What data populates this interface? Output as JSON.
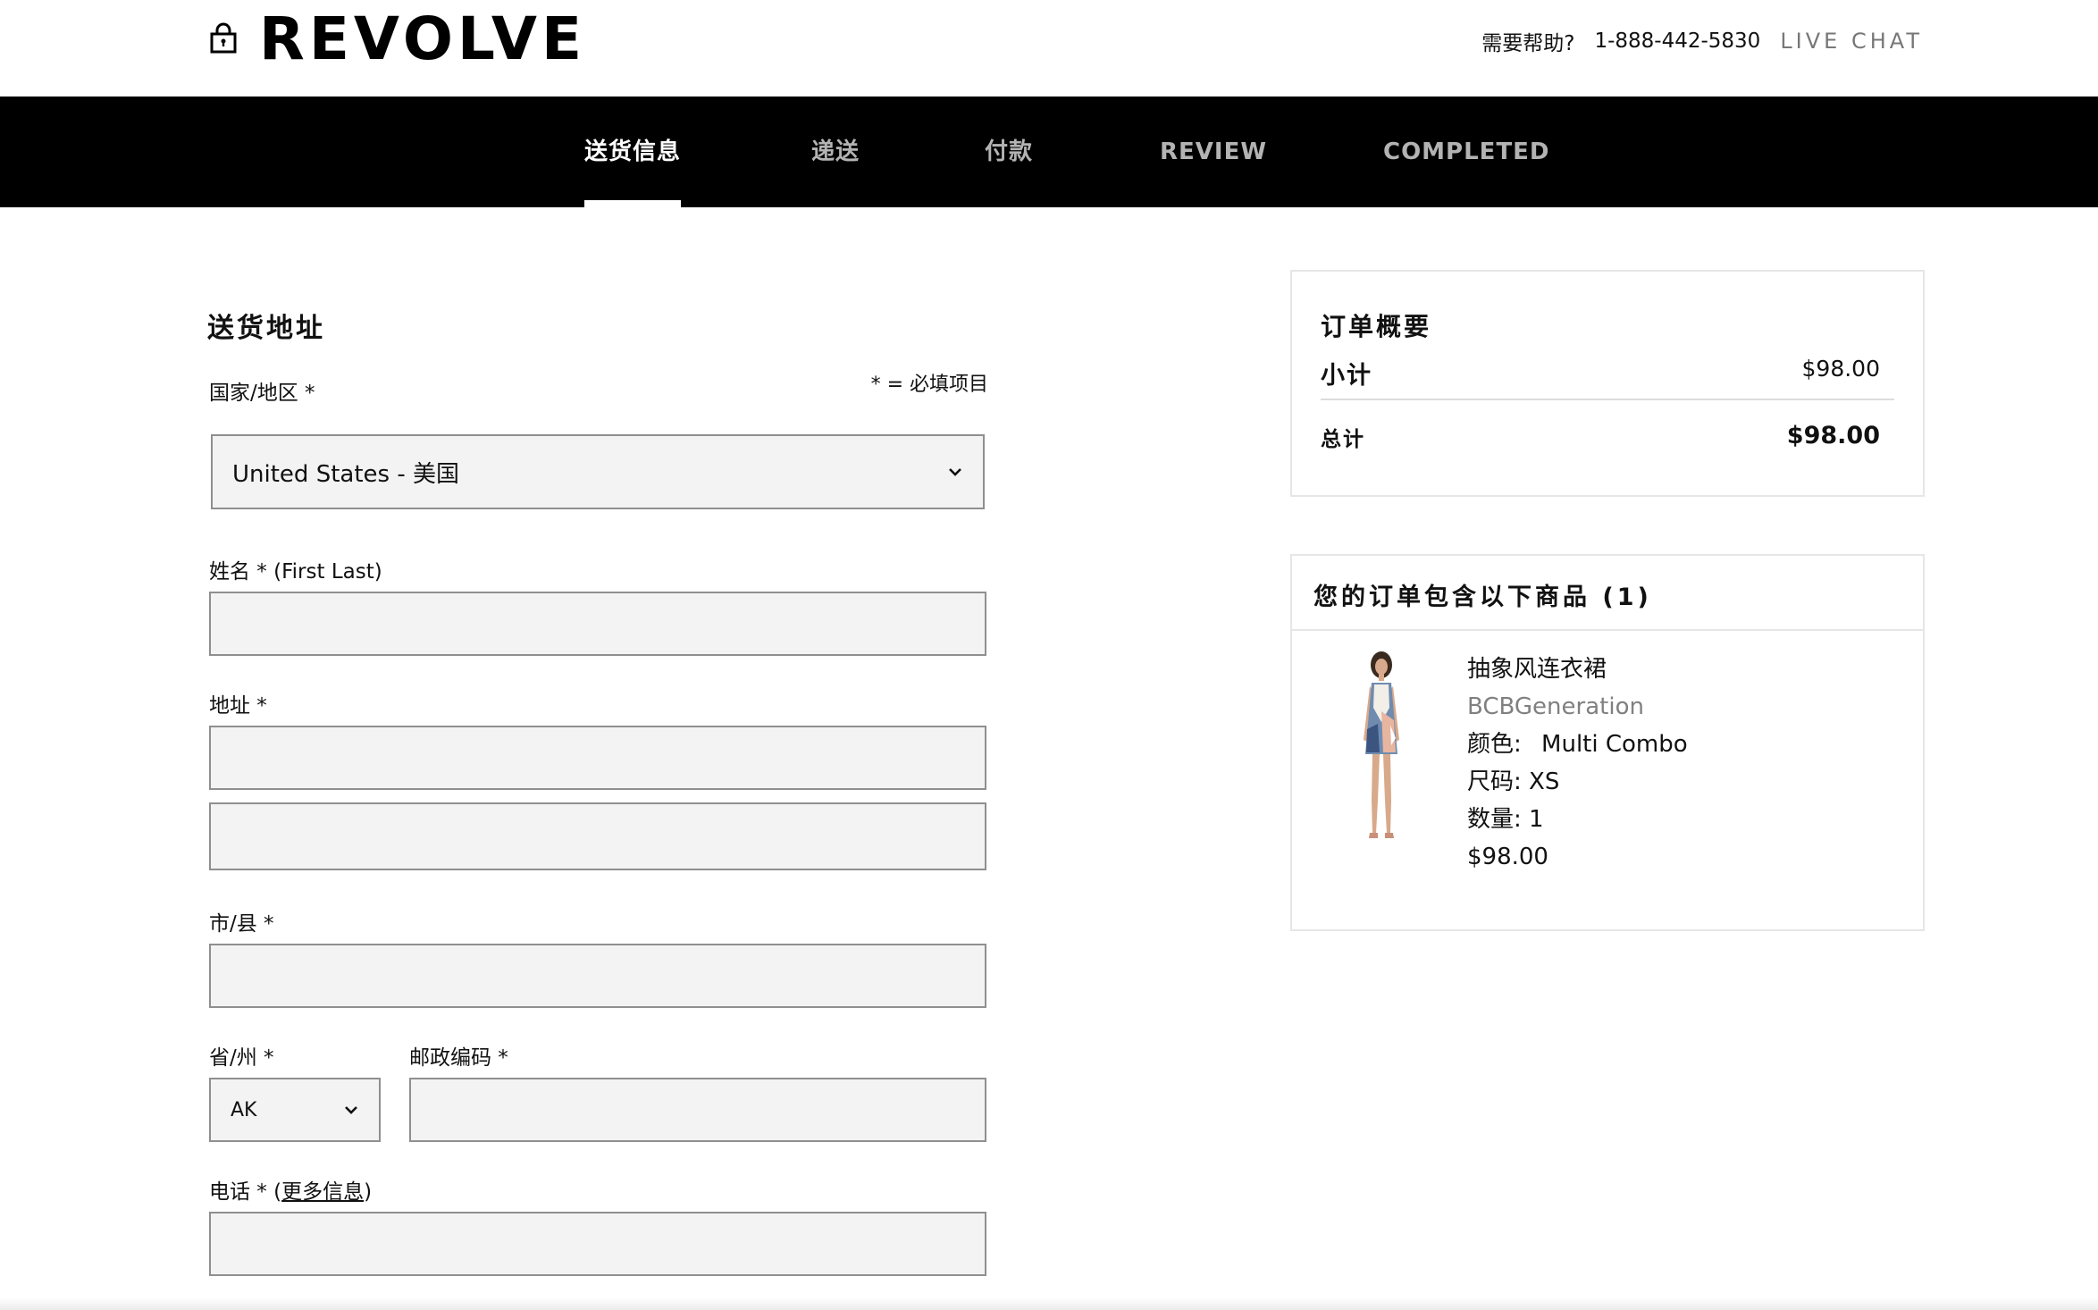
{
  "header": {
    "logo": "REVOLVE",
    "help_label": "需要帮助?",
    "phone": "1-888-442-5830",
    "live_chat": "LIVE CHAT"
  },
  "steps": [
    {
      "label": "送货信息",
      "active": true
    },
    {
      "label": "递送",
      "active": false
    },
    {
      "label": "付款",
      "active": false
    },
    {
      "label": "REVIEW",
      "active": false
    },
    {
      "label": "COMPLETED",
      "active": false
    }
  ],
  "form": {
    "title": "送货地址",
    "required_note": "* = 必填项目",
    "country": {
      "label": "国家/地区 *",
      "value": "United States - 美国"
    },
    "name": {
      "label": "姓名 *",
      "hint": "(First Last)",
      "value": ""
    },
    "address": {
      "label": "地址 *",
      "line1": "",
      "line2": ""
    },
    "city": {
      "label": "市/县 *",
      "value": ""
    },
    "state": {
      "label": "省/州 *",
      "value": "AK"
    },
    "zip": {
      "label": "邮政编码 *",
      "value": ""
    },
    "phone": {
      "label": "电话 *",
      "open_paren": " (",
      "more_info": "更多信息",
      "close_paren": ")",
      "value": ""
    }
  },
  "summary": {
    "title": "订单概要",
    "subtotal_label": "小计",
    "subtotal_value": "$98.00",
    "total_label": "总计",
    "total_value": "$98.00"
  },
  "items": {
    "title": "您的订单包含以下商品 (1)",
    "products": [
      {
        "name": "抽象风连衣裙",
        "brand": "BCBGeneration",
        "color_label": "颜色:",
        "color_value": "Multi Combo",
        "size_label": "尺码:",
        "size_value": "XS",
        "qty_label": "数量:",
        "qty_value": "1",
        "price": "$98.00"
      }
    ]
  },
  "colors": {
    "nav_background": "#000000",
    "nav_active": "#ffffff",
    "nav_inactive": "#b3b3b3",
    "input_background": "#f3f3f3",
    "brand_text": "#808080"
  },
  "icons": {
    "lock": "lock-icon",
    "chevron": "chevron-down-icon"
  }
}
